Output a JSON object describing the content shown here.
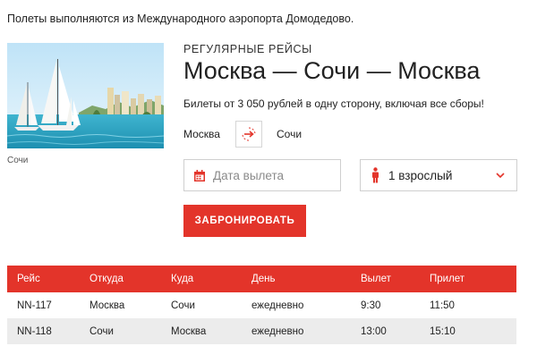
{
  "notice": "Полеты выполняются из Международного аэропорта Домодедово.",
  "photo": {
    "caption": "Сочи"
  },
  "route": {
    "kicker": "РЕГУЛЯРНЫЕ РЕЙСЫ",
    "title": "Москва — Сочи — Москва",
    "price_line": "Билеты от 3 050 рублей в одну сторону, включая все сборы!"
  },
  "direction": {
    "from": "Москва",
    "to": "Сочи"
  },
  "search": {
    "date_placeholder": "Дата вылета",
    "passengers": "1 взрослый",
    "book_label": "ЗАБРОНИРОВАТЬ"
  },
  "colors": {
    "accent": "#e3342a",
    "row_alt": "#ececec"
  },
  "icons": [
    "calendar-icon",
    "person-icon",
    "chevron-down-icon",
    "swap-arrow-icon"
  ],
  "table": {
    "headers": [
      "Рейс",
      "Откуда",
      "Куда",
      "День",
      "Вылет",
      "Прилет"
    ],
    "rows": [
      [
        "NN-117",
        "Москва",
        "Сочи",
        "ежедневно",
        "9:30",
        "11:50"
      ],
      [
        "NN-118",
        "Сочи",
        "Москва",
        "ежедневно",
        "13:00",
        "15:10"
      ]
    ]
  }
}
